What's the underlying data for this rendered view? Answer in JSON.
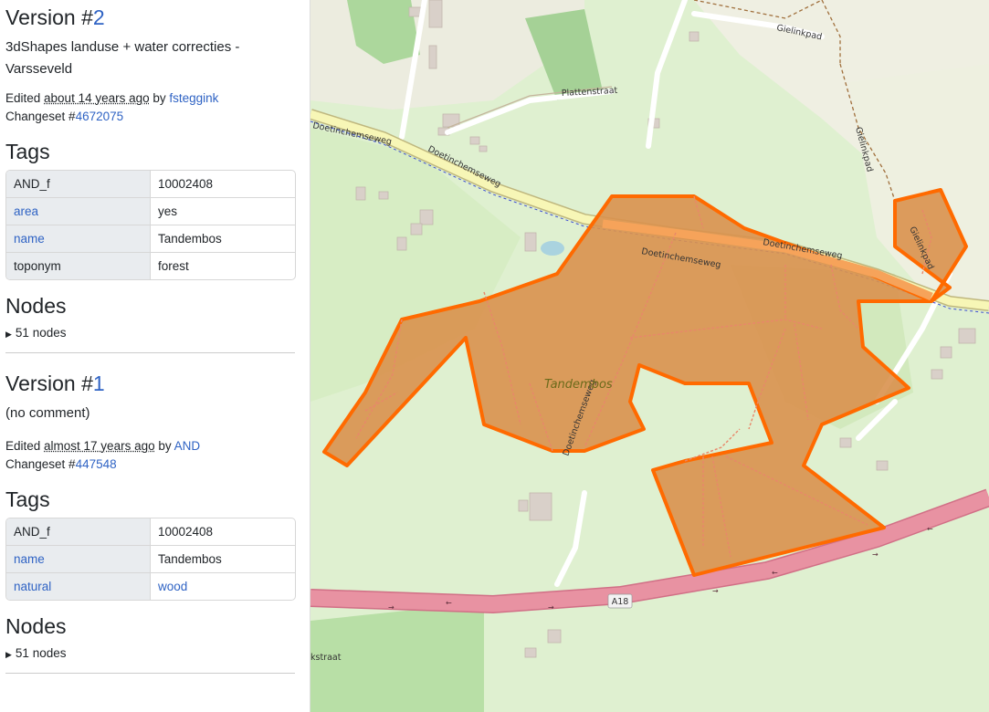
{
  "versions": [
    {
      "title_prefix": "Version #",
      "number": "2",
      "comment": "3dShapes landuse + water correcties - Varsseveld",
      "edited_prefix": "Edited ",
      "edited_time": "about 14 years ago",
      "by_text": " by ",
      "user": "fsteggink",
      "changeset_prefix": "Changeset #",
      "changeset": "4672075",
      "tags_title": "Tags",
      "tags": [
        {
          "key": "AND_f",
          "value": "10002408"
        },
        {
          "key": "area",
          "value": "yes"
        },
        {
          "key": "name",
          "value": "Tandembos"
        },
        {
          "key": "toponym",
          "value": "forest"
        }
      ],
      "nodes_title": "Nodes",
      "nodes_summary": "51 nodes"
    },
    {
      "title_prefix": "Version #",
      "number": "1",
      "comment": "(no comment)",
      "edited_prefix": "Edited ",
      "edited_time": "almost 17 years ago",
      "by_text": " by ",
      "user": "AND",
      "changeset_prefix": "Changeset #",
      "changeset": "447548",
      "tags_title": "Tags",
      "tags": [
        {
          "key": "AND_f",
          "value": "10002408"
        },
        {
          "key": "name",
          "value": "Tandembos"
        },
        {
          "key": "natural",
          "value": "wood"
        }
      ],
      "nodes_title": "Nodes",
      "nodes_summary": "51 nodes"
    }
  ],
  "map": {
    "labels": {
      "gielinkpad_top": "Gielinkpad",
      "gielinkpad_side": "Gielinkpad",
      "gielinkpad_inner": "Gielinkpad",
      "plattenstraat": "Plattenstraat",
      "doetinchemseweg_1": "Doetinchemseweg",
      "doetinchemseweg_2": "Doetinchemseweg",
      "doetinchemseweg_3": "Doetinchemseweg",
      "doetinchemseweg_4": "Doetinchemseweg",
      "doetinchemseweg_5": "Doetinchemseweg",
      "area_name": "Tandembos",
      "a18": "A18",
      "kstraat": "kstraat"
    },
    "colors": {
      "highlight_fill": "#d9914e",
      "highlight_stroke": "#ff6a00",
      "motorway": "#e892a2",
      "meadow": "#cdebb0",
      "link": "#2f63c4"
    }
  }
}
